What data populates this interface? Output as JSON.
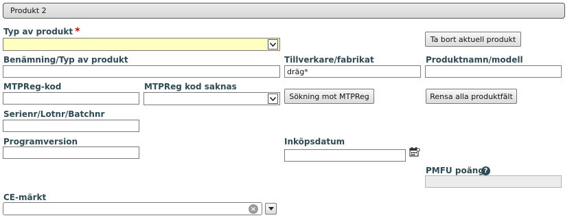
{
  "section": {
    "title": "Produkt 2"
  },
  "fields": {
    "typ_av_produkt": {
      "label": "Typ av produkt",
      "required_mark": "*",
      "value": ""
    },
    "benamning": {
      "label": "Benämning/Typ av produkt",
      "value": ""
    },
    "tillverkare": {
      "label": "Tillverkare/fabrikat",
      "value": "dräg*"
    },
    "produktnamn": {
      "label": "Produktnamn/modell",
      "value": ""
    },
    "mtpreg_kod": {
      "label": "MTPReg-kod",
      "value": ""
    },
    "mtpreg_saknas": {
      "label": "MTPReg kod saknas",
      "value": ""
    },
    "serienr": {
      "label": "Serienr/Lotnr/Batchnr",
      "value": ""
    },
    "programversion": {
      "label": "Programversion",
      "value": ""
    },
    "inkopsdatum": {
      "label": "Inköpsdatum",
      "value": ""
    },
    "pmfu": {
      "label": "PMFU poäng",
      "value": ""
    },
    "ce_markt": {
      "label": "CE-märkt",
      "value": ""
    }
  },
  "buttons": {
    "remove_product": "Ta bort aktuell produkt",
    "search_mtpreg": "Sökning mot MTPReg",
    "clear_fields": "Rensa alla produktfält"
  },
  "icons": {
    "help": "?",
    "clear": "×"
  }
}
